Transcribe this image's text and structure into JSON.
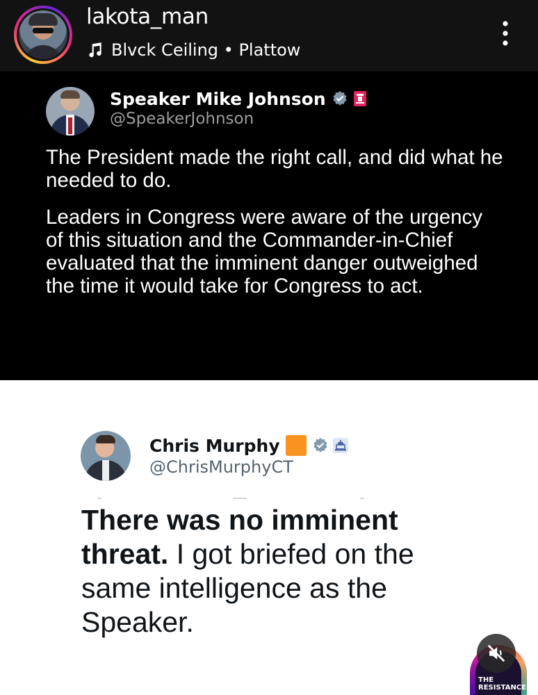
{
  "story": {
    "username": "lakota_man",
    "music_track": "Blvck Ceiling • Plattow",
    "icons": {
      "music": "music-note-icon",
      "more": "more-vertical-icon"
    }
  },
  "tweet_1": {
    "display_name": "Speaker Mike Johnson",
    "handle": "@SpeakerJohnson",
    "paragraphs": [
      "The President made the right call, and did what he needed to do.",
      "Leaders in Congress were aware of the urgency of this situation and the Commander-in-Chief evaluated that the imminent danger outweighed the time it would take for Congress to act."
    ],
    "icons": {
      "verified": "verified-badge-icon",
      "affiliation": "government-seal-icon"
    },
    "colors": {
      "background": "#000000",
      "text": "#ffffff",
      "handle": "#9e9e9e"
    }
  },
  "tweet_2": {
    "display_name": "Chris Murphy",
    "handle": "@ChrisMurphyCT",
    "bold_text": "There was no imminent threat.",
    "regular_text": " I got briefed on the same intelligence as the Speaker.",
    "icons": {
      "emoji": "orange-square-icon",
      "verified": "verified-badge-icon",
      "affiliation": "capitol-building-icon"
    },
    "colors": {
      "background": "#ffffff",
      "text": "#0f1419",
      "handle": "#536471",
      "emoji": "#f7931e"
    }
  },
  "watermark": {
    "label": "THE RESISTANCE",
    "icons": {
      "mute": "speaker-muted-icon"
    }
  }
}
